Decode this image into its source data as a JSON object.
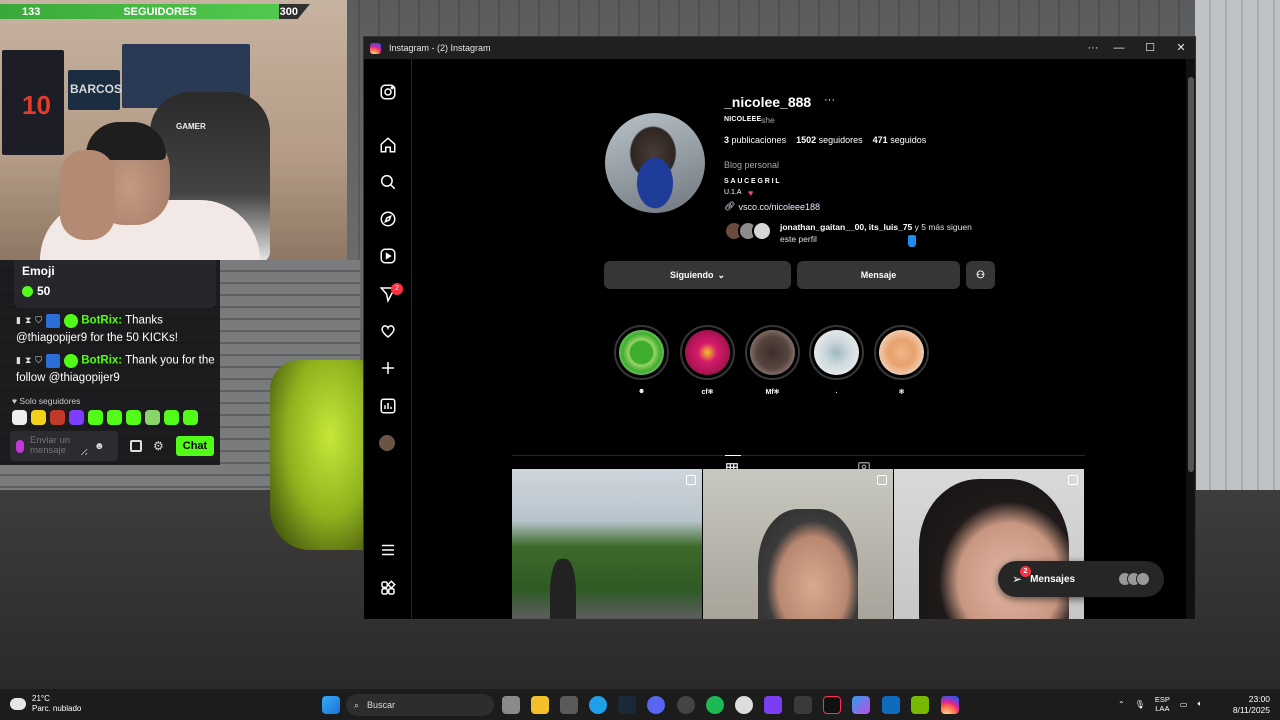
{
  "stream": {
    "follower_goal": {
      "current": "133",
      "label": "SEGUIDORES",
      "target": "300",
      "progress_fraction": 0.44
    },
    "poster_text": "10",
    "poster_brand": "BARCOS",
    "chair_brand": "GAMER"
  },
  "chat": {
    "goal_title": "Emoji",
    "goal_value": "50",
    "messages": [
      {
        "user": "BotRix:",
        "text": " Thanks @thiagopijer9 for the 50 KICKs!"
      },
      {
        "user": "BotRix:",
        "text": " Thank you for the follow @thiagopijer9"
      }
    ],
    "followers_only_label": "Solo seguidores",
    "input_placeholder": "Enviar un mensaje",
    "send_label": "Chat"
  },
  "window": {
    "title": "Instagram - (2) Instagram",
    "more": "···",
    "minimize": "—",
    "maximize": "☐",
    "close": "✕"
  },
  "sidebar": {
    "items": [
      {
        "name": "instagram-logo-icon"
      },
      {
        "name": "home-icon"
      },
      {
        "name": "search-icon"
      },
      {
        "name": "explore-icon"
      },
      {
        "name": "reels-icon"
      },
      {
        "name": "messages-icon",
        "badge": "2"
      },
      {
        "name": "notifications-icon"
      },
      {
        "name": "create-icon"
      },
      {
        "name": "dashboard-icon"
      },
      {
        "name": "profile-avatar"
      },
      {
        "name": "more-menu-icon"
      },
      {
        "name": "also-from-meta-icon"
      }
    ]
  },
  "profile": {
    "username": "_nicolee_888",
    "more": "···",
    "display_name": "NICOLEEE",
    "pronouns": "she",
    "posts_count": "3",
    "posts_label": "publicaciones",
    "followers_count": "1502",
    "followers_label": "seguidores",
    "following_count": "471",
    "following_label": "seguidos",
    "category": "Blog personal",
    "bio_line_1": "SAUCEGRIL",
    "bio_line_2": "U.1.A",
    "link": "vsco.co/nicoleee188",
    "followed_by_names": "jonathan_gaitan__00, its_luis_75",
    "followed_by_rest": " y 5 más siguen este perfil",
    "following_button": "Siguiendo",
    "message_button": "Mensaje"
  },
  "highlights": [
    {
      "label": "☻",
      "color": "#3fae2f"
    },
    {
      "label": "cf❃",
      "color": "#d61a6b"
    },
    {
      "label": "Mf❃",
      "color": "#3b2f2d"
    },
    {
      "label": ".",
      "color": "#cfd9de"
    },
    {
      "label": "❃",
      "color": "#e8a16c"
    }
  ],
  "messages_pill": {
    "label": "Mensajes",
    "badge": "2"
  },
  "taskbar": {
    "temperature": "21°C",
    "weather": "Parc. nublado",
    "search": "Buscar",
    "lang_1": "ESP",
    "lang_2": "LAA",
    "time": "23:00",
    "date": "8/11/2025"
  }
}
